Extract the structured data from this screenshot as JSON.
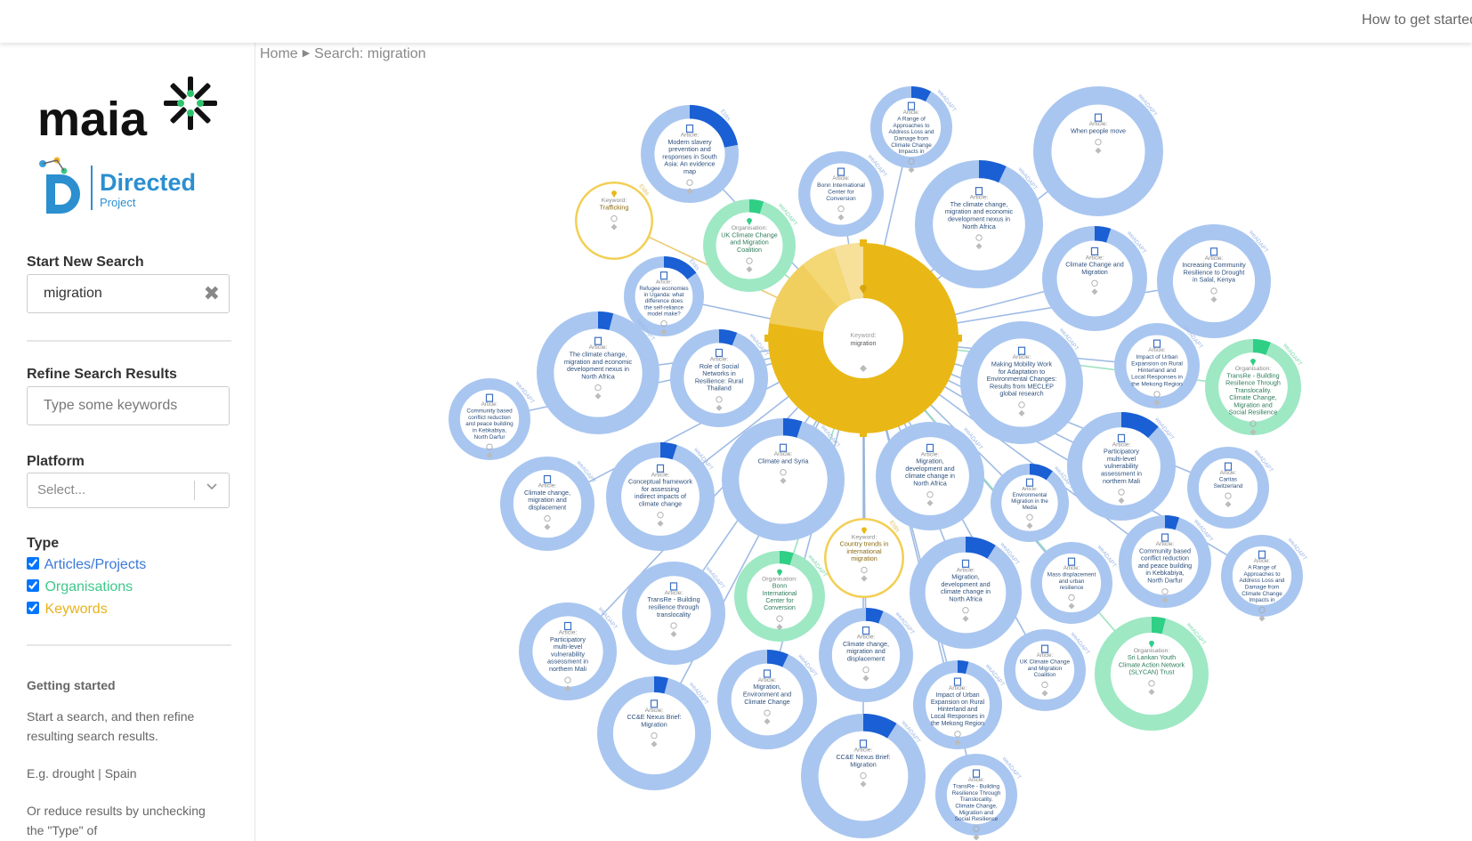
{
  "header": {
    "help_link": "How to get started"
  },
  "breadcrumb": {
    "home": "Home",
    "current": "Search: migration"
  },
  "sidebar": {
    "brand": "maia",
    "partner": {
      "name": "Directed",
      "sub": "Project"
    },
    "new_search": {
      "label": "Start New Search",
      "value": "migration"
    },
    "refine": {
      "label": "Refine Search Results",
      "placeholder": "Type some keywords"
    },
    "platform": {
      "label": "Platform",
      "placeholder": "Select..."
    },
    "type": {
      "label": "Type",
      "options": [
        {
          "label": "Articles/Projects",
          "checked": true,
          "color": "#3b78d8"
        },
        {
          "label": "Organisations",
          "checked": true,
          "color": "#3ec98a"
        },
        {
          "label": "Keywords",
          "checked": true,
          "color": "#e8b21b"
        }
      ]
    },
    "getting_started": {
      "title": "Getting started",
      "para1": "Start a search, and then refine resulting search results.",
      "para2": "E.g. drought | Spain",
      "para3": "Or reduce results by unchecking the \"Type\" of"
    }
  },
  "colors": {
    "article": "#a9c6f0",
    "article_accent": "#1a5fd3",
    "article_text": "#2c4f7c",
    "organisation": "#9ee8c4",
    "organisation_accent": "#2fcf86",
    "keyword": "#f2cf55",
    "keyword_main": "#eab816"
  },
  "graph": {
    "center": {
      "type": "Keyword",
      "title": "migration"
    },
    "nodes": [
      {
        "type": "Article",
        "title": "A Range of Approaches to Address Loss and Damage from Climate Change Impacts in Bangladesh",
        "tag": "weADAPT",
        "accent": 0.08
      },
      {
        "type": "Article",
        "title": "Modern slavery prevention and responses in South Asia: An evidence map",
        "tag": "Eldis",
        "accent": 0.22
      },
      {
        "type": "Article",
        "title": "When people move",
        "tag": "weADAPT",
        "accent": 0
      },
      {
        "type": "Article",
        "title": "Bonn International Center for Conversion",
        "tag": "weADAPT",
        "accent": 0
      },
      {
        "type": "Keyword",
        "title": "Trafficking",
        "tag": "Eldis",
        "accent": 0
      },
      {
        "type": "Organisation",
        "title": "UK Climate Change and Migration Coalition",
        "tag": "weADAPT",
        "accent": 0.05
      },
      {
        "type": "Article",
        "title": "The climate change, migration and economic development nexus in North Africa",
        "tag": "weADAPT",
        "accent": 0.07
      },
      {
        "type": "Article",
        "title": "Climate Change and Migration",
        "tag": "weADAPT",
        "accent": 0.05
      },
      {
        "type": "Article",
        "title": "Increasing Community Resilience to Drought in Salal, Kenya",
        "tag": "weADAPT",
        "accent": 0
      },
      {
        "type": "Article",
        "title": "Refugee economies in Uganda: what difference does the self-reliance model make?",
        "tag": "Eldis",
        "accent": 0.15
      },
      {
        "type": "Article",
        "title": "The climate change, migration and economic development nexus in North Africa",
        "tag": "weADAPT",
        "accent": 0.04
      },
      {
        "type": "Article",
        "title": "Role of Social Networks in Resilience: Rural Thailand",
        "tag": "weADAPT",
        "accent": 0.06
      },
      {
        "type": "Article",
        "title": "Community based conflict reduction and peace building in Kebkabiya, North Darfur",
        "tag": "weADAPT",
        "accent": 0
      },
      {
        "type": "Article",
        "title": "Making Mobility Work for Adaptation to Environmental Changes: Results from MECLEP global research",
        "tag": "weADAPT",
        "accent": 0
      },
      {
        "type": "Article",
        "title": "Impact of Urban Expansion on Rural Hinterland and Local Responses in the Mekong Region",
        "tag": "weADAPT",
        "accent": 0
      },
      {
        "type": "Organisation",
        "title": "TransRe - Building Resilience Through Translocality. Climate Change, Migration and Social Resilience of Rural Communities in Thailand",
        "tag": "weADAPT",
        "accent": 0.06
      },
      {
        "type": "Article",
        "title": "Climate and Syria",
        "tag": "weADAPT",
        "accent": 0.05
      },
      {
        "type": "Article",
        "title": "Conceptual framework for assessing indirect impacts of climate change",
        "tag": "weADAPT",
        "accent": 0.05
      },
      {
        "type": "Article",
        "title": "Climate change, migration and displacement",
        "tag": "weADAPT",
        "accent": 0
      },
      {
        "type": "Article",
        "title": "Migration, development and climate change in North Africa",
        "tag": "weADAPT",
        "accent": 0
      },
      {
        "type": "Article",
        "title": "Environmental Migration in the Media",
        "tag": "weADAPT",
        "accent": 0.1
      },
      {
        "type": "Article",
        "title": "Participatory multi-level vulnerability assessment in northern Mali",
        "tag": "weADAPT",
        "accent": 0.12
      },
      {
        "type": "Article",
        "title": "Caritas Switzerland",
        "tag": "weADAPT",
        "accent": 0
      },
      {
        "type": "Keyword",
        "title": "Country trends in international migration",
        "tag": "Eldis",
        "accent": 0
      },
      {
        "type": "Organisation",
        "title": "Bonn International Center for Conversion",
        "tag": "weADAPT",
        "accent": 0.05
      },
      {
        "type": "Article",
        "title": "TransRe - Building resilience through translocality",
        "tag": "weADAPT",
        "accent": 0
      },
      {
        "type": "Article",
        "title": "Migration, development and climate change in North Africa",
        "tag": "weADAPT",
        "accent": 0.09
      },
      {
        "type": "Article",
        "title": "Mass displacement and urban resilience",
        "tag": "weADAPT",
        "accent": 0
      },
      {
        "type": "Article",
        "title": "Community based conflict reduction and peace building in Kebkabiya, North Darfur",
        "tag": "weADAPT",
        "accent": 0.05
      },
      {
        "type": "Article",
        "title": "A Range of Approaches to Address Loss and Damage from Climate Change Impacts in Bangladesh",
        "tag": "weADAPT",
        "accent": 0
      },
      {
        "type": "Article",
        "title": "Participatory multi-level vulnerability assessment in northern Mali",
        "tag": "weADAPT",
        "accent": 0
      },
      {
        "type": "Article",
        "title": "Climate change, migration and displacement",
        "tag": "weADAPT",
        "accent": 0.06
      },
      {
        "type": "Article",
        "title": "UK Climate Change and Migration Coalition",
        "tag": "weADAPT",
        "accent": 0
      },
      {
        "type": "Organisation",
        "title": "Sri Lankan Youth Climate Action Network (SLYCAN) Trust",
        "tag": "weADAPT",
        "accent": 0.04
      },
      {
        "type": "Article",
        "title": "Migration, Environment and Climate Change",
        "tag": "weADAPT",
        "accent": 0.07
      },
      {
        "type": "Article",
        "title": "Impact of Urban Expansion on Rural Hinterland and Local Responses in the Mekong Region",
        "tag": "weADAPT",
        "accent": 0.04
      },
      {
        "type": "Article",
        "title": "CC&E Nexus Brief: Migration",
        "tag": "weADAPT",
        "accent": 0.04
      },
      {
        "type": "Article",
        "title": "CC&E Nexus Brief: Migration",
        "tag": "weADAPT",
        "accent": 0.09
      },
      {
        "type": "Article",
        "title": "TransRe - Building Resilience Through Translocality. Climate Change, Migration and Social Resilience of Rural Communities in Thailand",
        "tag": "weADAPT",
        "accent": 0
      }
    ]
  }
}
